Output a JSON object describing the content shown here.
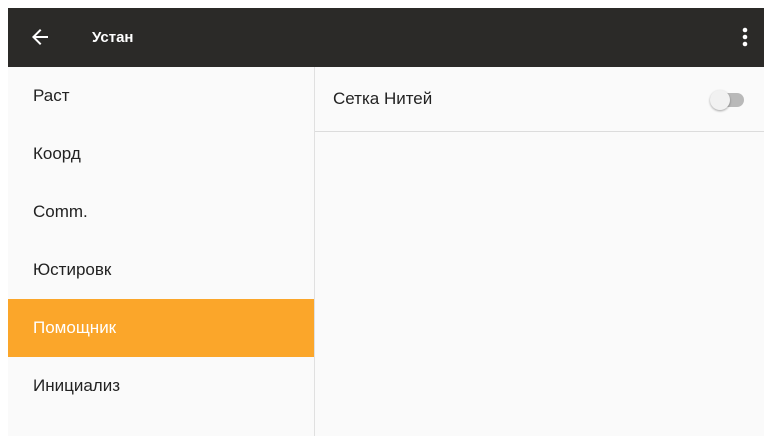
{
  "toolbar": {
    "title": "Устан",
    "back_icon": "arrow-left-icon",
    "menu_icon": "more-vert-icon",
    "background": "#2b2a28"
  },
  "sidebar": {
    "items": [
      {
        "label": "Раст",
        "active": false
      },
      {
        "label": "Коорд",
        "active": false
      },
      {
        "label": "Comm.",
        "active": false
      },
      {
        "label": "Юстировк",
        "active": false
      },
      {
        "label": "Помощник",
        "active": true
      },
      {
        "label": "Инициализ",
        "active": false
      }
    ],
    "active_color": "#fba62a"
  },
  "content": {
    "settings": [
      {
        "label": "Сетка Нитей",
        "enabled": false
      }
    ]
  }
}
